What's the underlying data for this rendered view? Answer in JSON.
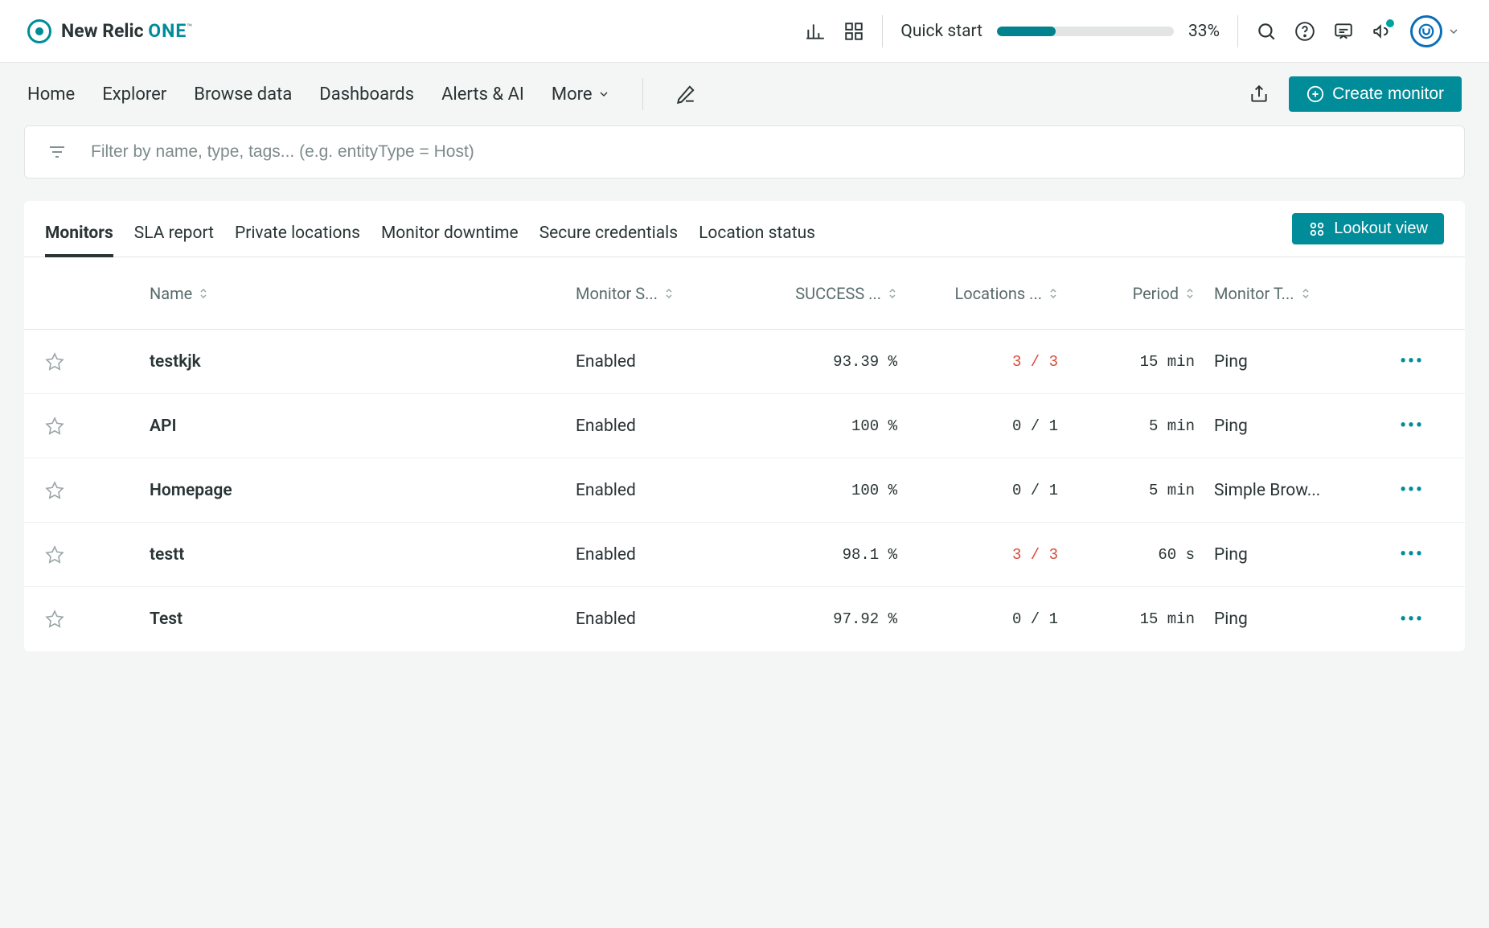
{
  "brand": {
    "name": "New Relic",
    "suffix": "ONE",
    "tm": "™"
  },
  "topbar": {
    "quick_start_label": "Quick start",
    "progress_text": "33%",
    "progress_pct": 33
  },
  "nav": {
    "items": [
      "Home",
      "Explorer",
      "Browse data",
      "Dashboards",
      "Alerts & AI"
    ],
    "more": "More",
    "create_monitor": "Create monitor"
  },
  "filter": {
    "placeholder": "Filter by name, type, tags... (e.g. entityType = Host)"
  },
  "tabs": {
    "items": [
      "Monitors",
      "SLA report",
      "Private locations",
      "Monitor downtime",
      "Secure credentials",
      "Location status"
    ],
    "active": 0,
    "lookout": "Lookout view"
  },
  "table": {
    "headers": {
      "name": "Name",
      "status": "Monitor S...",
      "success": "SUCCESS ...",
      "locations": "Locations ...",
      "period": "Period",
      "type": "Monitor T..."
    },
    "rows": [
      {
        "status_color": "teal",
        "name": "testkjk",
        "status": "Enabled",
        "success": "93.39 %",
        "locations": "3 / 3",
        "loc_fail": true,
        "period": "15 min",
        "type": "Ping"
      },
      {
        "status_color": "gray",
        "name": "API",
        "status": "Enabled",
        "success": "100 %",
        "locations": "0 / 1",
        "loc_fail": false,
        "period": "5 min",
        "type": "Ping"
      },
      {
        "status_color": "gray",
        "name": "Homepage",
        "status": "Enabled",
        "success": "100 %",
        "locations": "0 / 1",
        "loc_fail": false,
        "period": "5 min",
        "type": "Simple Brow..."
      },
      {
        "status_color": "gray",
        "name": "testt",
        "status": "Enabled",
        "success": "98.1 %",
        "locations": "3 / 3",
        "loc_fail": true,
        "period": "60 s",
        "type": "Ping"
      },
      {
        "status_color": "gray",
        "name": "Test",
        "status": "Enabled",
        "success": "97.92 %",
        "locations": "0 / 1",
        "loc_fail": false,
        "period": "15 min",
        "type": "Ping"
      }
    ]
  }
}
